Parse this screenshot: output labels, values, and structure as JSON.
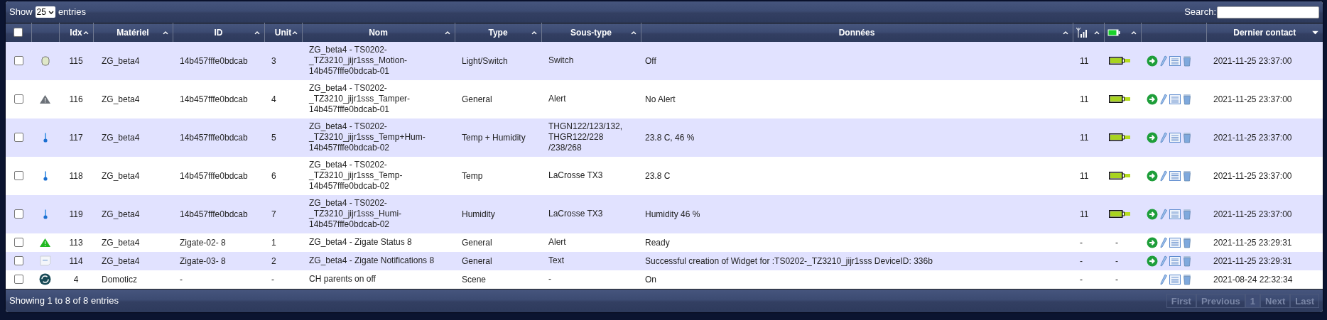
{
  "length_control": {
    "before": "Show",
    "value": "25",
    "after": "entries"
  },
  "search": {
    "label": "Search:"
  },
  "columns": [
    {
      "kind": "checkbox",
      "checked": false,
      "sortable": false,
      "sorted_descending": false
    },
    {
      "kind": "blank",
      "sortable": false,
      "sorted_descending": false
    },
    {
      "kind": "text",
      "label": "Idx",
      "sortable": true,
      "sorted_descending": false
    },
    {
      "kind": "text",
      "label": "Matériel",
      "sortable": true,
      "sorted_descending": false
    },
    {
      "kind": "text",
      "label": "ID",
      "sortable": true,
      "sorted_descending": false
    },
    {
      "kind": "text",
      "label": "Unit",
      "sortable": true,
      "sorted_descending": false
    },
    {
      "kind": "text",
      "label": "Nom",
      "sortable": true,
      "sorted_descending": false
    },
    {
      "kind": "text",
      "label": "Type",
      "sortable": true,
      "sorted_descending": false
    },
    {
      "kind": "text",
      "label": "Sous-type",
      "sortable": true,
      "sorted_descending": false
    },
    {
      "kind": "text",
      "label": "Données",
      "sortable": true,
      "sorted_descending": false
    },
    {
      "kind": "signal",
      "sortable": true,
      "sorted_descending": false
    },
    {
      "kind": "battery",
      "sortable": true,
      "sorted_descending": false
    },
    {
      "kind": "blank",
      "sortable": false,
      "sorted_descending": false
    },
    {
      "kind": "text",
      "label": "Dernier contact",
      "sortable": true,
      "sorted_descending": true
    }
  ],
  "rows": [
    {
      "checked": false,
      "kind": "switch",
      "idx": "115",
      "hardware": "ZG_beta4",
      "id": "14b457fffe0bdcab",
      "unit": "3",
      "name": "ZG_beta4 - TS0202-_TZ3210_jijr1sss_Motion-14b457fffe0bdcab-01",
      "type": "Light/Switch",
      "subtype": "Switch",
      "data": "Off",
      "signal": "11",
      "battery": {
        "level": 1
      },
      "log_button": true,
      "last_seen": "2021-11-25 23:37:00"
    },
    {
      "checked": false,
      "kind": "alert-grey",
      "idx": "116",
      "hardware": "ZG_beta4",
      "id": "14b457fffe0bdcab",
      "unit": "4",
      "name": "ZG_beta4 - TS0202-_TZ3210_jijr1sss_Tamper-14b457fffe0bdcab-01",
      "type": "General",
      "subtype": "Alert",
      "data": "No Alert",
      "signal": "11",
      "battery": {
        "level": 1
      },
      "log_button": true,
      "last_seen": "2021-11-25 23:37:00"
    },
    {
      "checked": false,
      "kind": "thermometer",
      "idx": "117",
      "hardware": "ZG_beta4",
      "id": "14b457fffe0bdcab",
      "unit": "5",
      "name": "ZG_beta4 - TS0202-_TZ3210_jijr1sss_Temp+Hum-14b457fffe0bdcab-02",
      "type": "Temp + Humidity",
      "subtype": "THGN122/123/132, THGR122/228 /238/268",
      "data": "23.8 C, 46 %",
      "signal": "11",
      "battery": {
        "level": 1
      },
      "log_button": true,
      "last_seen": "2021-11-25 23:37:00"
    },
    {
      "checked": false,
      "kind": "thermometer",
      "idx": "118",
      "hardware": "ZG_beta4",
      "id": "14b457fffe0bdcab",
      "unit": "6",
      "name": "ZG_beta4 - TS0202-_TZ3210_jijr1sss_Temp-14b457fffe0bdcab-02",
      "type": "Temp",
      "subtype": "LaCrosse TX3",
      "data": "23.8 C",
      "signal": "11",
      "battery": {
        "level": 1
      },
      "log_button": true,
      "last_seen": "2021-11-25 23:37:00"
    },
    {
      "checked": false,
      "kind": "thermometer",
      "idx": "119",
      "hardware": "ZG_beta4",
      "id": "14b457fffe0bdcab",
      "unit": "7",
      "name": "ZG_beta4 - TS0202-_TZ3210_jijr1sss_Humi-14b457fffe0bdcab-02",
      "type": "Humidity",
      "subtype": "LaCrosse TX3",
      "data": "Humidity 46 %",
      "signal": "11",
      "battery": {
        "level": 1
      },
      "log_button": true,
      "last_seen": "2021-11-25 23:37:00"
    },
    {
      "checked": false,
      "kind": "alert-green",
      "idx": "113",
      "hardware": "ZG_beta4",
      "id": "Zigate-02- 8",
      "unit": "1",
      "name": "ZG_beta4 - Zigate Status 8",
      "type": "General",
      "subtype": "Alert",
      "data": "Ready",
      "signal": "-",
      "battery_text": "-",
      "log_button": true,
      "last_seen": "2021-11-25 23:29:31"
    },
    {
      "checked": false,
      "kind": "text",
      "idx": "114",
      "hardware": "ZG_beta4",
      "id": "Zigate-03- 8",
      "unit": "2",
      "name": "ZG_beta4 - Zigate Notifications 8",
      "type": "General",
      "subtype": "Text",
      "data": "Successful creation of Widget for :TS0202-_TZ3210_jijr1sss DeviceID: 336b",
      "signal": "-",
      "battery_text": "-",
      "log_button": true,
      "last_seen": "2021-11-25 23:29:31"
    },
    {
      "checked": false,
      "kind": "scene",
      "idx": "4",
      "hardware": "Domoticz",
      "id": "-",
      "unit": "-",
      "name": "CH parents on off",
      "type": "Scene",
      "subtype": "-",
      "data": "On",
      "signal": "-",
      "battery_text": "-",
      "log_button": false,
      "last_seen": "2021-08-24 22:32:34"
    }
  ],
  "info": "Showing 1 to 8 of 8 entries",
  "pagination": [
    {
      "label": "First",
      "disabled": true,
      "selected": false
    },
    {
      "label": "Previous",
      "disabled": true,
      "selected": false
    },
    {
      "label": "1",
      "disabled": true,
      "selected": true
    },
    {
      "label": "Next",
      "disabled": true,
      "selected": false
    },
    {
      "label": "Last",
      "disabled": true,
      "selected": false
    }
  ]
}
